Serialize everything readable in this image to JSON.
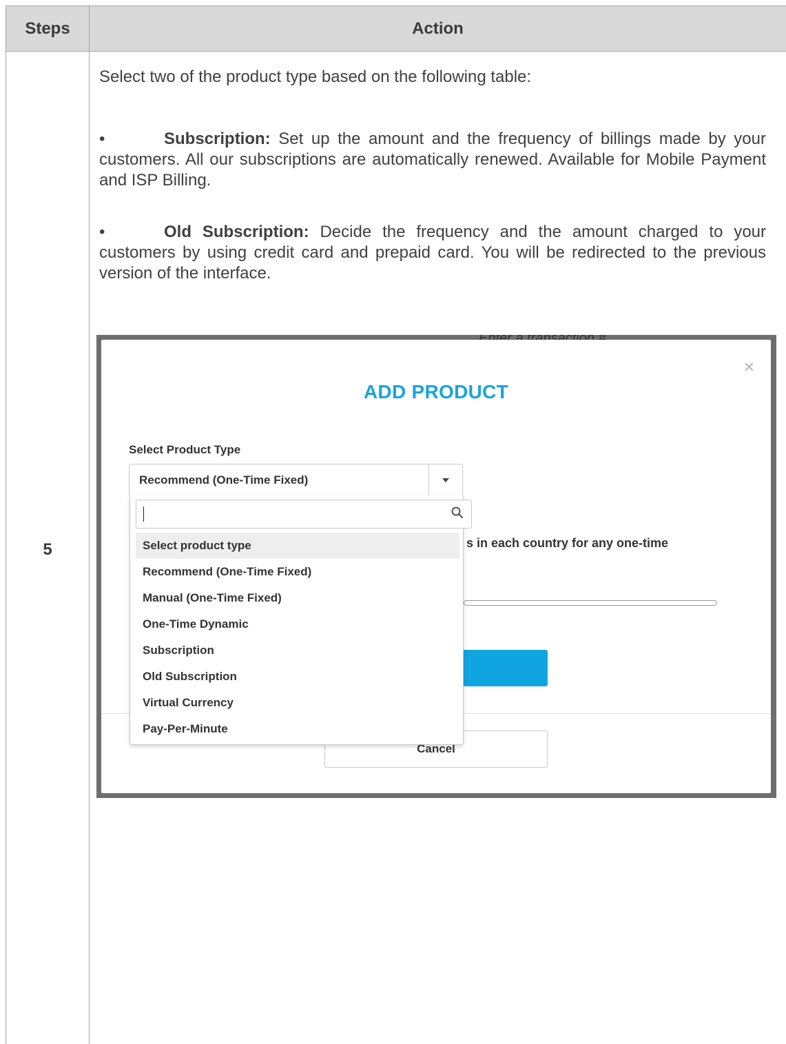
{
  "table": {
    "header_steps": "Steps",
    "header_action": "Action",
    "step_number": "5"
  },
  "content": {
    "intro": "Select two of the product type based on the following table:",
    "bullets": [
      {
        "marker": "•",
        "term": "Subscription:",
        "text": " Set up the amount and the frequency of billings made by your customers. All our subscriptions are automatically renewed. Available for Mobile Payment and ISP Billing."
      },
      {
        "marker": "•",
        "term": "Old Subscription:",
        "text": " Decide the frequency and the amount charged to your customers by using credit card and prepaid card. You will be redirected to the previous version of the interface."
      }
    ]
  },
  "screenshot": {
    "background_hint": "Enter a transaction #",
    "modal": {
      "close_icon": "×",
      "title": "ADD PRODUCT",
      "field_label": "Select Product Type",
      "selected_value": "Recommend (One-Time Fixed)",
      "search_value": "",
      "partial_text": "s in each country for any one-time",
      "cancel_label": "Cancel",
      "options": [
        "Select product type",
        "Recommend (One-Time Fixed)",
        "Manual (One-Time Fixed)",
        "One-Time Dynamic",
        "Subscription",
        "Old Subscription",
        "Virtual Currency",
        "Pay-Per-Minute"
      ],
      "highlighted_option": "Select product type"
    },
    "colors": {
      "title": "#1aa3dc",
      "primary_button": "#10a5e0",
      "backdrop": "#6e6e6e",
      "header_bg": "#d9d9d9"
    },
    "icons": {
      "dropdown": "chevron-down-icon",
      "search": "search-icon",
      "close": "close-icon"
    }
  }
}
